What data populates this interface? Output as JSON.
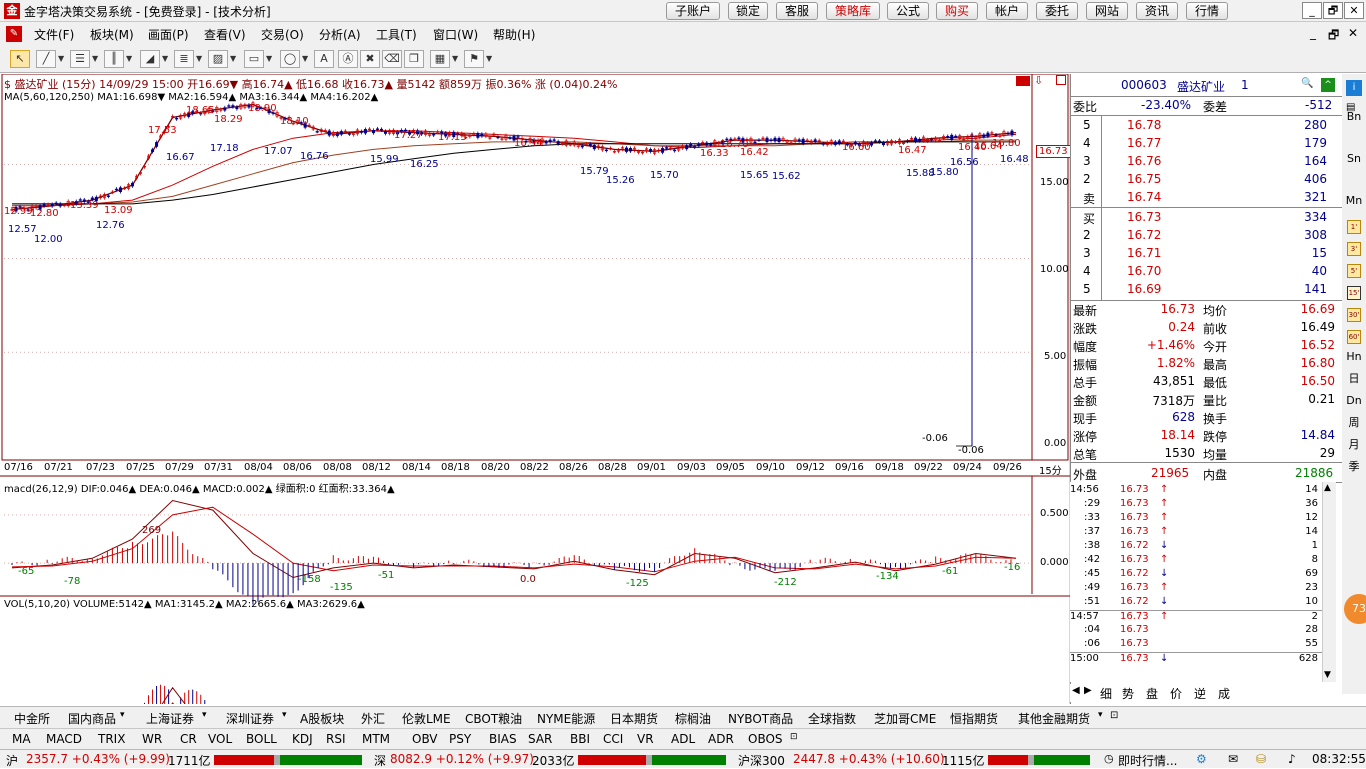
{
  "window": {
    "title": "金字塔决策交易系统 - [免费登录] - [技术分析]",
    "top_buttons": [
      "子账户",
      "锁定",
      "客服",
      "策略库",
      "公式",
      "购买",
      "帐户",
      "委托",
      "网站",
      "资讯",
      "行情"
    ],
    "win_controls": [
      "_",
      "🗗",
      "✕"
    ],
    "menus": [
      "文件(F)",
      "板块(M)",
      "画面(P)",
      "查看(V)",
      "交易(O)",
      "分析(A)",
      "工具(T)",
      "窗口(W)",
      "帮助(H)"
    ],
    "mdi_controls": [
      "_",
      "🗗",
      "✕"
    ]
  },
  "chart": {
    "info_line": "$ 盛达矿业 (15分) 14/09/29 15:00 开16.69▼ 高16.74▲ 低16.68 收16.73▲ 量5142 额859万 振0.36% 涨 (0.04)0.24%",
    "ma_line": "MA(5,60,120,250) MA1:16.698▼ MA2:16.594▲ MA3:16.344▲ MA4:16.202▲",
    "macd_line": "macd(26,12,9) DIF:0.046▲ DEA:0.046▲ MACD:0.002▲ 绿面积:0 红面积:33.364▲",
    "vol_line": "VOL(5,10,20) VOLUME:5142▲ MA1:3145.2▲ MA2:2665.6▲ MA3:2629.6▲",
    "price_axis": [
      "15.00",
      "10.00",
      "5.00",
      "0.00"
    ],
    "last_price_label": "16.73",
    "macd_axis": [
      "0.500",
      "0.000"
    ],
    "period_label": "15分",
    "low_labels": [
      "-0.06",
      "-0.06"
    ],
    "dates": [
      "07/16",
      "07/21",
      "07/23",
      "07/25",
      "07/29",
      "07/31",
      "08/04",
      "08/06",
      "08/08",
      "08/12",
      "08/14",
      "08/18",
      "08/20",
      "08/22",
      "08/26",
      "08/28",
      "09/01",
      "09/03",
      "09/05",
      "09/10",
      "09/12",
      "09/16",
      "09/18",
      "09/22",
      "09/24",
      "09/26"
    ],
    "price_annotations_red": [
      "12.99",
      "12.80",
      "13.39",
      "13.09",
      "17.53",
      "18.65",
      "18.29",
      "18.90",
      "18.10",
      "17.27",
      "17.13",
      "16.94",
      "16.70",
      "16.60",
      "16.80",
      "16.47",
      "16.64",
      "16.40",
      "16.42",
      "16.33"
    ],
    "price_annotations_blue": [
      "12.57",
      "12.00",
      "12.76",
      "16.67",
      "17.18",
      "17.07",
      "16.76",
      "15.99",
      "16.25",
      "15.79",
      "15.26",
      "15.70",
      "15.65",
      "15.62",
      "15.88",
      "15.80",
      "16.56",
      "16.48"
    ],
    "macd_annotations": [
      "-65",
      "-78",
      "269",
      "0.0",
      "-158",
      "-135",
      "-51",
      "-125",
      "-212",
      "-134",
      "-61",
      "-16"
    ]
  },
  "chart_data": [
    {
      "type": "line",
      "title": "盛达矿业 (15分)",
      "x": [
        "07/16",
        "07/21",
        "07/23",
        "07/25",
        "07/29",
        "07/31",
        "08/04",
        "08/06",
        "08/08",
        "08/12",
        "08/14",
        "08/18",
        "08/20",
        "08/22",
        "08/26",
        "08/28",
        "09/01",
        "09/03",
        "09/05",
        "09/10",
        "09/12",
        "09/16",
        "09/18",
        "09/22",
        "09/24",
        "09/26"
      ],
      "series": [
        {
          "name": "收",
          "values": [
            12.6,
            12.8,
            13.1,
            13.9,
            17.5,
            17.9,
            18.2,
            17.3,
            16.6,
            16.8,
            16.7,
            16.6,
            16.5,
            16.3,
            16.1,
            15.8,
            15.7,
            16.0,
            16.3,
            16.3,
            16.2,
            16.1,
            16.2,
            16.4,
            16.5,
            16.7
          ]
        },
        {
          "name": "MA2",
          "values": [
            12.8,
            12.8,
            12.9,
            13.1,
            13.9,
            14.9,
            15.8,
            16.4,
            16.7,
            16.8,
            16.8,
            16.7,
            16.6,
            16.5,
            16.4,
            16.2,
            16.0,
            15.9,
            16.0,
            16.1,
            16.1,
            16.2,
            16.2,
            16.3,
            16.4,
            16.6
          ]
        },
        {
          "name": "MA3",
          "values": [
            12.9,
            12.9,
            12.9,
            13.0,
            13.3,
            13.9,
            14.5,
            15.1,
            15.5,
            15.8,
            16.0,
            16.1,
            16.2,
            16.2,
            16.2,
            16.1,
            16.0,
            16.0,
            16.0,
            16.0,
            16.1,
            16.1,
            16.2,
            16.2,
            16.3,
            16.3
          ]
        },
        {
          "name": "MA4",
          "values": [
            12.9,
            12.9,
            12.9,
            12.9,
            13.1,
            13.4,
            13.8,
            14.2,
            14.6,
            15.0,
            15.3,
            15.6,
            15.8,
            16.0,
            16.1,
            16.1,
            16.1,
            16.1,
            16.1,
            16.1,
            16.1,
            16.1,
            16.2,
            16.2,
            16.2,
            16.2
          ]
        }
      ],
      "ylim": [
        0,
        19.5
      ]
    },
    {
      "type": "line",
      "title": "macd(26,12,9)",
      "x": [
        "07/16",
        "07/21",
        "07/23",
        "07/25",
        "07/29",
        "07/31",
        "08/04",
        "08/06",
        "08/08",
        "08/12",
        "08/14",
        "08/18",
        "08/20",
        "08/22",
        "08/26",
        "08/28",
        "09/01",
        "09/03",
        "09/05",
        "09/10",
        "09/12",
        "09/16",
        "09/18",
        "09/22",
        "09/24",
        "09/26"
      ],
      "series": [
        {
          "name": "DIF",
          "values": [
            -0.05,
            -0.02,
            0.05,
            0.25,
            0.65,
            0.55,
            0.1,
            -0.15,
            -0.05,
            0.0,
            -0.05,
            -0.02,
            -0.04,
            -0.06,
            0.02,
            -0.07,
            -0.12,
            0.1,
            0.05,
            -0.1,
            -0.05,
            0.01,
            -0.08,
            -0.01,
            0.1,
            0.05
          ]
        },
        {
          "name": "DEA",
          "values": [
            -0.04,
            -0.03,
            0.02,
            0.15,
            0.5,
            0.58,
            0.3,
            0.0,
            -0.08,
            -0.02,
            -0.03,
            -0.03,
            -0.03,
            -0.05,
            -0.01,
            -0.04,
            -0.09,
            0.02,
            0.06,
            -0.05,
            -0.06,
            -0.01,
            -0.06,
            -0.03,
            0.06,
            0.05
          ]
        }
      ],
      "ylim": [
        -0.3,
        0.8
      ]
    },
    {
      "type": "bar",
      "title": "VOL(5,10,20)",
      "categories": [
        "07/16",
        "07/21",
        "07/23",
        "07/25",
        "07/29",
        "07/31",
        "08/04",
        "08/06",
        "08/08",
        "08/12",
        "08/14",
        "08/18",
        "08/20",
        "08/22",
        "08/26",
        "08/28",
        "09/01",
        "09/03",
        "09/05",
        "09/10",
        "09/12",
        "09/16",
        "09/18",
        "09/22",
        "09/24",
        "09/26"
      ],
      "values": [
        800,
        1200,
        1500,
        6000,
        24000,
        9000,
        7000,
        4000,
        2500,
        1800,
        2000,
        1500,
        1400,
        1200,
        1300,
        1200,
        1600,
        2500,
        2000,
        1800,
        1700,
        1900,
        1800,
        1900,
        2600,
        2200
      ],
      "ylim": [
        0,
        26000
      ]
    }
  ],
  "quote": {
    "code": "000603",
    "name": "盛达矿业",
    "level": "1",
    "webi_label": "委比",
    "webi": "-23.40%",
    "weicha_label": "委差",
    "weicha": "-512",
    "asks": [
      {
        "level": "5",
        "price": "16.78",
        "vol": "280"
      },
      {
        "level": "4",
        "price": "16.77",
        "vol": "179"
      },
      {
        "level": "3",
        "price": "16.76",
        "vol": "164"
      },
      {
        "level": "2",
        "price": "16.75",
        "vol": "406"
      },
      {
        "level": "卖",
        "price": "16.74",
        "vol": "321"
      }
    ],
    "bids": [
      {
        "level": "买",
        "price": "16.73",
        "vol": "334"
      },
      {
        "level": "2",
        "price": "16.72",
        "vol": "308"
      },
      {
        "level": "3",
        "price": "16.71",
        "vol": "15"
      },
      {
        "level": "4",
        "price": "16.70",
        "vol": "40"
      },
      {
        "level": "5",
        "price": "16.69",
        "vol": "141"
      }
    ],
    "stats": [
      {
        "l1": "最新",
        "v1": "16.73",
        "c1": "red",
        "l2": "均价",
        "v2": "16.69",
        "c2": "red"
      },
      {
        "l1": "涨跌",
        "v1": "0.24",
        "c1": "red",
        "l2": "前收",
        "v2": "16.49",
        "c2": "blk"
      },
      {
        "l1": "幅度",
        "v1": "+1.46%",
        "c1": "red",
        "l2": "今开",
        "v2": "16.52",
        "c2": "red"
      },
      {
        "l1": "振幅",
        "v1": "1.82%",
        "c1": "red",
        "l2": "最高",
        "v2": "16.80",
        "c2": "red"
      },
      {
        "l1": "总手",
        "v1": "43,851",
        "c1": "blk",
        "l2": "最低",
        "v2": "16.50",
        "c2": "red"
      },
      {
        "l1": "金额",
        "v1": "7318万",
        "c1": "blk",
        "l2": "量比",
        "v2": "0.21",
        "c2": "blk"
      },
      {
        "l1": "现手",
        "v1": "628",
        "c1": "blu",
        "l2": "换手",
        "v2": "",
        "c2": "blk"
      },
      {
        "l1": "涨停",
        "v1": "18.14",
        "c1": "red",
        "l2": "跌停",
        "v2": "14.84",
        "c2": "blu"
      },
      {
        "l1": "总笔",
        "v1": "1530",
        "c1": "blk",
        "l2": "均量",
        "v2": "29",
        "c2": "blk"
      }
    ],
    "outer_label": "外盘",
    "outer": "21965",
    "inner_label": "内盘",
    "inner": "21886"
  },
  "ticks": [
    {
      "t": "14:56",
      "p": "16.73",
      "d": "↑",
      "v": "14"
    },
    {
      "t": ":29",
      "p": "16.73",
      "d": "↑",
      "v": "36"
    },
    {
      "t": ":33",
      "p": "16.73",
      "d": "↑",
      "v": "12"
    },
    {
      "t": ":37",
      "p": "16.73",
      "d": "↑",
      "v": "14"
    },
    {
      "t": ":38",
      "p": "16.72",
      "d": "↓",
      "v": "1"
    },
    {
      "t": ":42",
      "p": "16.73",
      "d": "↑",
      "v": "8"
    },
    {
      "t": ":45",
      "p": "16.72",
      "d": "↓",
      "v": "69"
    },
    {
      "t": ":49",
      "p": "16.73",
      "d": "↑",
      "v": "23"
    },
    {
      "t": ":51",
      "p": "16.72",
      "d": "↓",
      "v": "10"
    },
    {
      "t": "14:57",
      "p": "16.73",
      "d": "↑",
      "v": "2"
    },
    {
      "t": ":04",
      "p": "16.73",
      "d": "",
      "v": "28"
    },
    {
      "t": ":06",
      "p": "16.73",
      "d": "",
      "v": "55"
    },
    {
      "t": "15:00",
      "p": "16.73",
      "d": "↓",
      "v": "628"
    }
  ],
  "detail_tabs": [
    "细",
    "势",
    "盘",
    "价",
    "逆",
    "成"
  ],
  "sidebar": [
    "Bn",
    "Sn",
    "Mn",
    "Hn",
    "日",
    "Dn",
    "周",
    "月",
    "季"
  ],
  "sidebar_icons": [
    "1'",
    "3'",
    "5'",
    "15'",
    "30'",
    "60'"
  ],
  "market_tabs": [
    "中金所",
    "国内商品",
    "上海证券",
    "深圳证券",
    "A股板块",
    "外汇",
    "伦敦LME",
    "CBOT粮油",
    "NYME能源",
    "日本期货",
    "棕榈油",
    "NYBOT商品",
    "全球指数",
    "芝加哥CME",
    "恒指期货",
    "其他金融期货"
  ],
  "indicator_tabs": [
    "MA",
    "MACD",
    "TRIX",
    "WR",
    "CR",
    "VOL",
    "BOLL",
    "KDJ",
    "RSI",
    "MTM",
    "OBV",
    "PSY",
    "BIAS",
    "SAR",
    "BBI",
    "CCI",
    "VR",
    "ADL",
    "ADR",
    "OBOS"
  ],
  "status": {
    "sh_label": "沪",
    "sh": "2357.7 +0.43% (+9.99)",
    "sh_amt": "1711亿",
    "sz_label": "深",
    "sz": "8082.9 +0.12% (+9.97)",
    "sz_amt": "2033亿",
    "hs_label": "沪深300",
    "hs": "2447.8 +0.43% (+10.60)",
    "hs_amt": "1115亿",
    "msg": "即时行情...",
    "time": "08:32:55"
  },
  "orange_badge": "73",
  "colors": {
    "up": "#d00000",
    "down": "#00008b",
    "green": "#008000"
  }
}
